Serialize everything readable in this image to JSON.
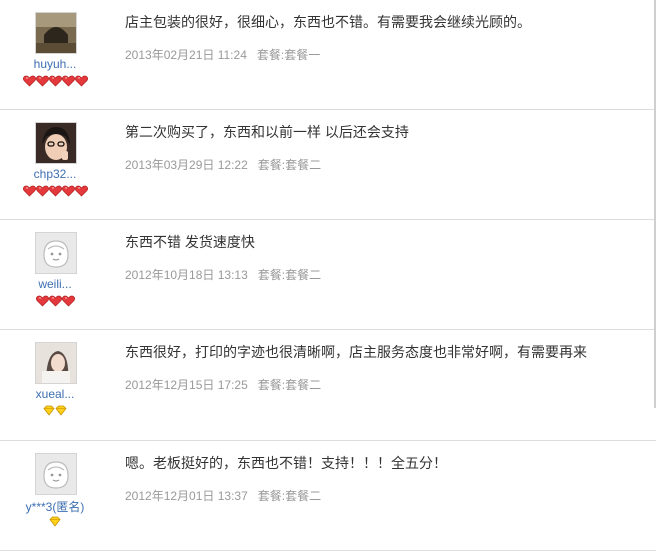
{
  "reviews": [
    {
      "username": "huyuh...",
      "avatar": "photo-archway",
      "badge_type": "red-heart-icon",
      "badge_count": 5,
      "content": "店主包装的很好，很细心，东西也不错。有需要我会继续光顾的。",
      "date": "2013年02月21日 11:24",
      "package": "套餐:套餐一"
    },
    {
      "username": "chp32...",
      "avatar": "photo-person",
      "badge_type": "red-heart-icon",
      "badge_count": 5,
      "content": "第二次购买了，东西和以前一样 以后还会支持",
      "date": "2013年03月29日 12:22",
      "package": "套餐:套餐二"
    },
    {
      "username": "weili...",
      "avatar": "default-face",
      "badge_type": "red-heart-icon",
      "badge_count": 3,
      "content": "东西不错 发货速度快",
      "date": "2012年10月18日 13:13",
      "package": "套餐:套餐二"
    },
    {
      "username": "xueal...",
      "avatar": "photo-girl",
      "badge_type": "yellow-diamond-icon",
      "badge_count": 2,
      "content": "东西很好，打印的字迹也很清晰啊，店主服务态度也非常好啊，有需要再来",
      "date": "2012年12月15日 17:25",
      "package": "套餐:套餐二"
    },
    {
      "username": "y***3(匿名)",
      "avatar": "default-face",
      "badge_type": "yellow-diamond-icon",
      "badge_count": 1,
      "content": "嗯。老板挺好的，东西也不错！支持！！！全五分！",
      "date": "2012年12月01日 13:37",
      "package": "套餐:套餐二"
    }
  ]
}
